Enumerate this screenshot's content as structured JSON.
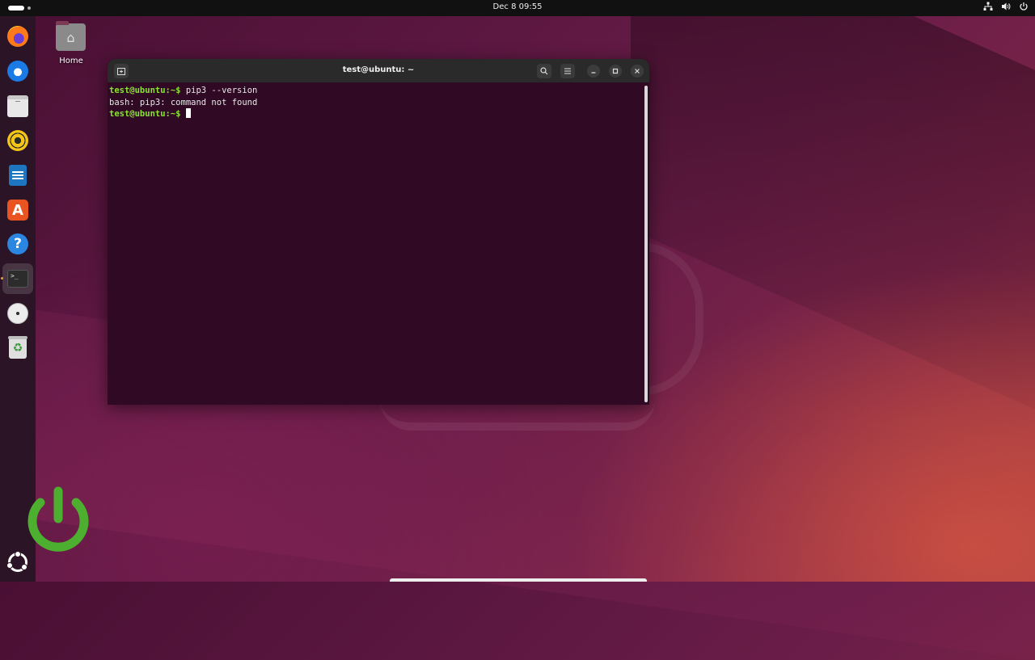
{
  "topbar": {
    "clock": "Dec 8  09:55",
    "tray": {
      "network_icon": "network-icon",
      "volume_icon": "volume-icon",
      "power_icon": "power-icon"
    }
  },
  "dock": {
    "items": [
      {
        "name": "firefox",
        "icon": "firefox-icon",
        "running": false
      },
      {
        "name": "thunderbird",
        "icon": "thunderbird-icon",
        "running": false
      },
      {
        "name": "files",
        "icon": "files-icon",
        "running": false
      },
      {
        "name": "rhythmbox",
        "icon": "rhythmbox-icon",
        "running": false
      },
      {
        "name": "libreoffice-writer",
        "icon": "writer-icon",
        "running": false
      },
      {
        "name": "app-center",
        "icon": "app-center-icon",
        "glyph": "A",
        "running": false
      },
      {
        "name": "help",
        "icon": "help-icon",
        "glyph": "?",
        "running": false
      },
      {
        "name": "terminal",
        "icon": "terminal-icon",
        "glyph": ">_",
        "running": true
      },
      {
        "name": "optical-drive",
        "icon": "disc-icon",
        "running": false
      },
      {
        "name": "trash",
        "icon": "trash-icon",
        "glyph": "♻",
        "running": false
      }
    ],
    "show_apps_icon": "ubuntu-icon"
  },
  "desktop": {
    "home_label": "Home"
  },
  "terminal": {
    "title": "test@ubuntu: ~",
    "lines": [
      {
        "prompt": "test@ubuntu:~$",
        "text": " pip3 --version"
      },
      {
        "prompt": "",
        "text": "bash: pip3: command not found"
      },
      {
        "prompt": "test@ubuntu:~$",
        "text": " "
      }
    ],
    "colors": {
      "background": "#300a24",
      "prompt": "#8ae234",
      "text": "#e8e8e8"
    }
  },
  "colors": {
    "accent": "#e95420",
    "dock_bg": "#2b1426",
    "power_logo": "#4caf2f"
  }
}
